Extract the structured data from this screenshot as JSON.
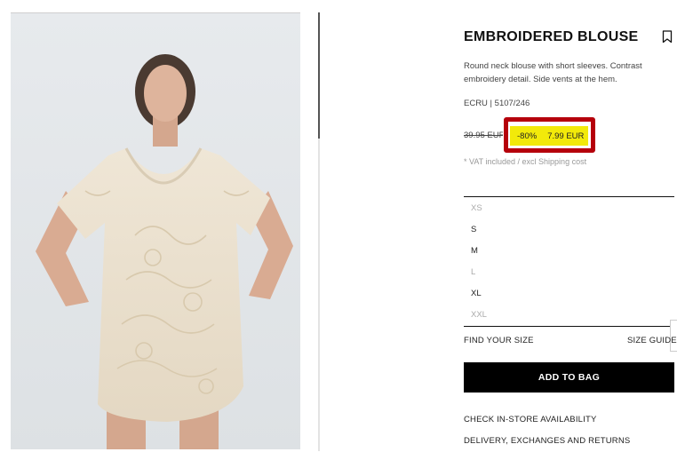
{
  "product": {
    "title": "EMBROIDERED BLOUSE",
    "description": "Round neck blouse with short sleeves. Contrast embroidery detail. Side vents at the hem.",
    "reference": "ECRU | 5107/246",
    "old_price": "39.95 EUR",
    "discount": "-80%",
    "current_price": "7.99 EUR",
    "vat_note": "* VAT included / excl Shipping cost"
  },
  "sizes": [
    {
      "label": "XS",
      "available": false
    },
    {
      "label": "S",
      "available": true
    },
    {
      "label": "M",
      "available": true
    },
    {
      "label": "L",
      "available": false
    },
    {
      "label": "XL",
      "available": true
    },
    {
      "label": "XXL",
      "available": false
    }
  ],
  "size_help": {
    "find_your_size": "FIND YOUR SIZE",
    "size_guide": "SIZE GUIDE"
  },
  "actions": {
    "add_to_bag": "ADD TO BAG",
    "check_store": "CHECK IN-STORE AVAILABILITY",
    "delivery": "DELIVERY, EXCHANGES AND RETURNS"
  },
  "icons": {
    "bookmark": "bookmark-icon"
  },
  "colors": {
    "promo_highlight": "#f2ea0a",
    "annotation_box": "#b5000b",
    "button_bg": "#000000"
  }
}
